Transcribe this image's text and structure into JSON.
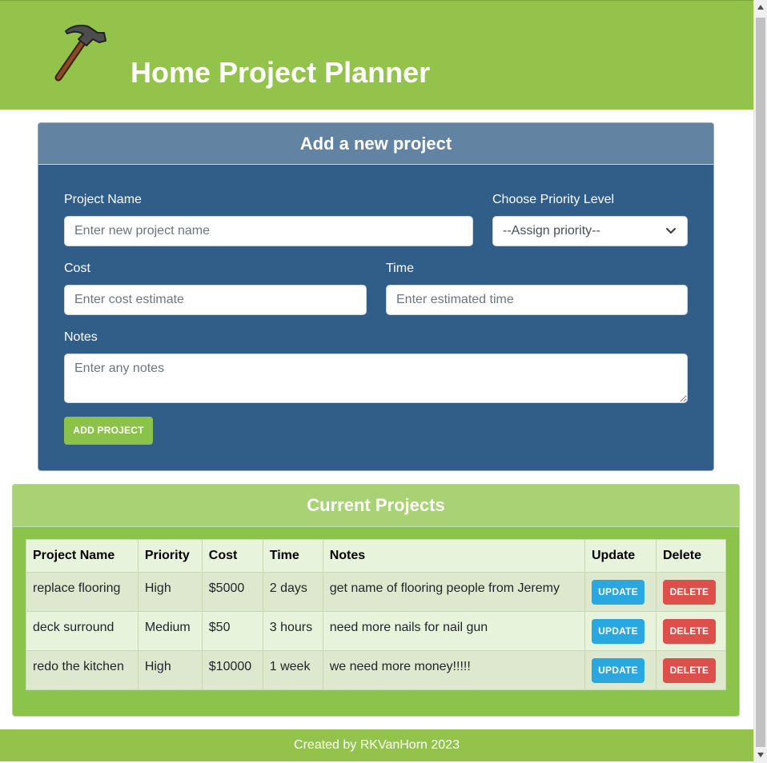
{
  "header": {
    "title": "Home Project Planner",
    "logo_icon": "hammer-icon"
  },
  "add_form": {
    "title": "Add a new project",
    "name_label": "Project Name",
    "name_placeholder": "Enter new project name",
    "priority_label": "Choose Priority Level",
    "priority_selected": "--Assign priority--",
    "cost_label": "Cost",
    "cost_placeholder": "Enter cost estimate",
    "time_label": "Time",
    "time_placeholder": "Enter estimated time",
    "notes_label": "Notes",
    "notes_placeholder": "Enter any notes",
    "submit_label": "ADD PROJECT"
  },
  "projects": {
    "title": "Current Projects",
    "columns": [
      "Project Name",
      "Priority",
      "Cost",
      "Time",
      "Notes",
      "Update",
      "Delete"
    ],
    "rows": [
      {
        "name": "replace flooring",
        "priority": "High",
        "cost": "$5000",
        "time": "2 days",
        "notes": "get name of flooring people from Jeremy"
      },
      {
        "name": "deck surround",
        "priority": "Medium",
        "cost": "$50",
        "time": "3 hours",
        "notes": "need more nails for nail gun"
      },
      {
        "name": "redo the kitchen",
        "priority": "High",
        "cost": "$10000",
        "time": "1 week",
        "notes": "we need more money!!!!!"
      }
    ],
    "update_label": "UPDATE",
    "delete_label": "DELETE"
  },
  "footer": {
    "text": "Created by RKVanHorn 2023"
  },
  "colors": {
    "header_green": "#94c34b",
    "form_blue": "#315d89",
    "form_header_blue": "#6283a2",
    "update_blue": "#29a7e0",
    "delete_red": "#dc4f4a"
  }
}
